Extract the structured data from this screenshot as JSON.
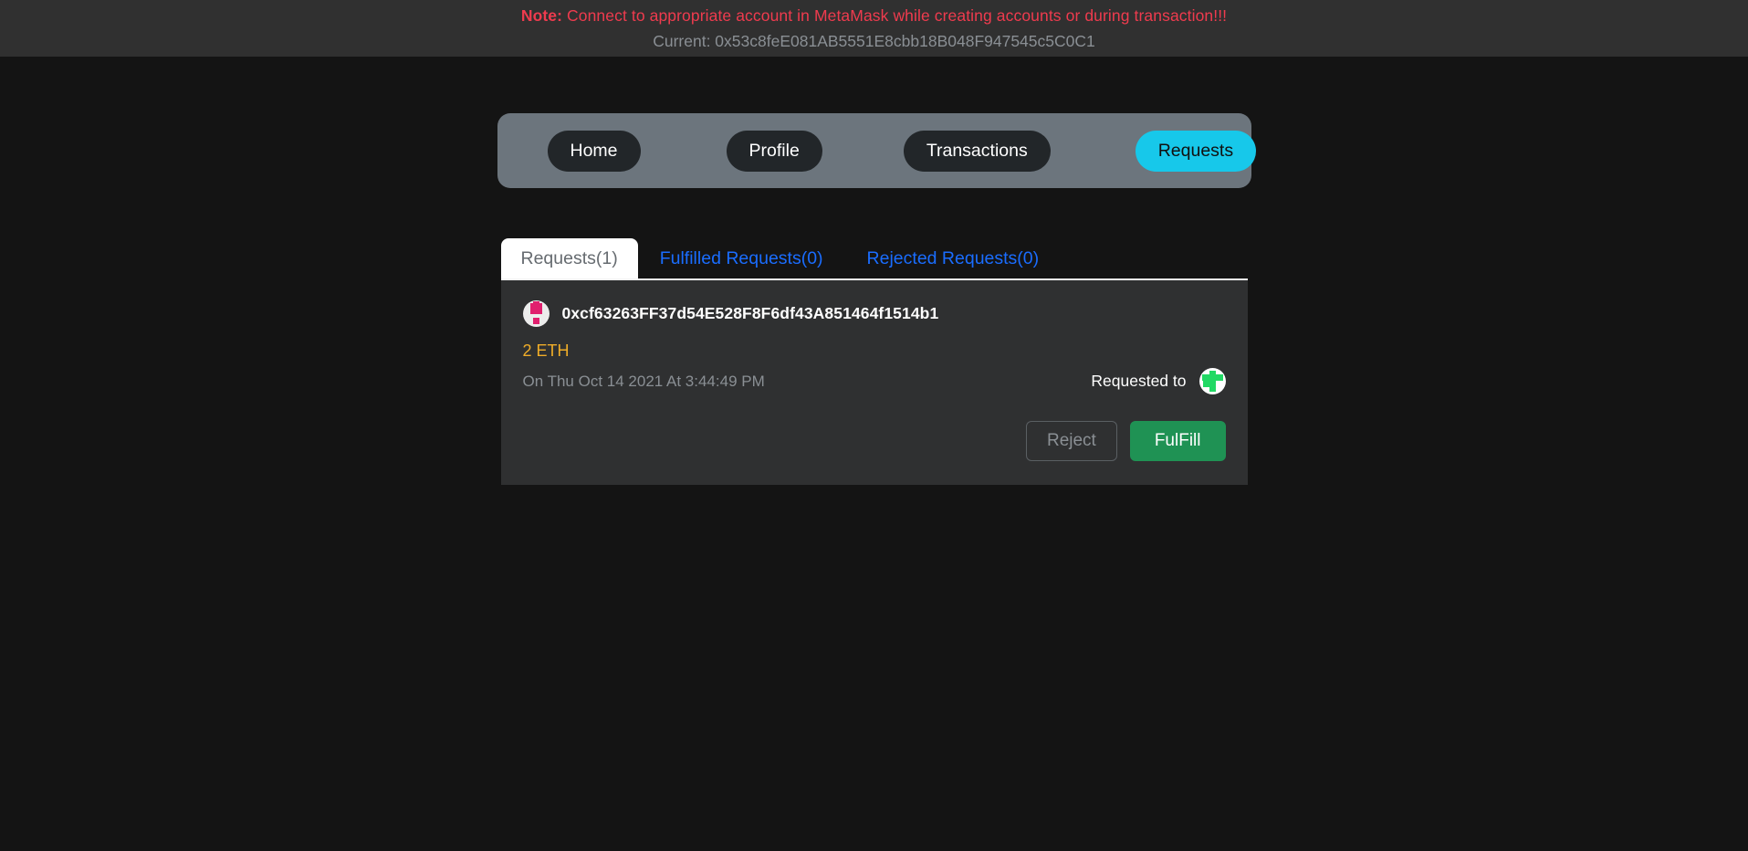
{
  "notice": {
    "label": "Note:",
    "message": "Connect to appropriate account in MetaMask while creating accounts or during transaction!!!",
    "current": "Current: 0x53c8feE081AB5551E8cbb18B048F947545c5C0C1"
  },
  "nav": {
    "items": [
      {
        "label": "Home",
        "active": false
      },
      {
        "label": "Profile",
        "active": false
      },
      {
        "label": "Transactions",
        "active": false
      },
      {
        "label": "Requests",
        "active": true
      }
    ],
    "active_bg": "#17c8ea",
    "bar_bg": "#6c757d"
  },
  "tabs": [
    {
      "label": "Requests(1)",
      "active": true
    },
    {
      "label": "Fulfilled Requests(0)",
      "active": false
    },
    {
      "label": "Rejected Requests(0)",
      "active": false
    }
  ],
  "request": {
    "from_address": "0xcf63263FF37d54E528F8F6df43A851464f1514b1",
    "amount": "2 ETH",
    "amount_color": "#f0ad28",
    "date": "On Thu Oct 14 2021 At 3:44:49 PM",
    "requested_to_label": "Requested to",
    "reject_label": "Reject",
    "fulfill_label": "FulFill",
    "fulfill_color": "#1f9254"
  }
}
